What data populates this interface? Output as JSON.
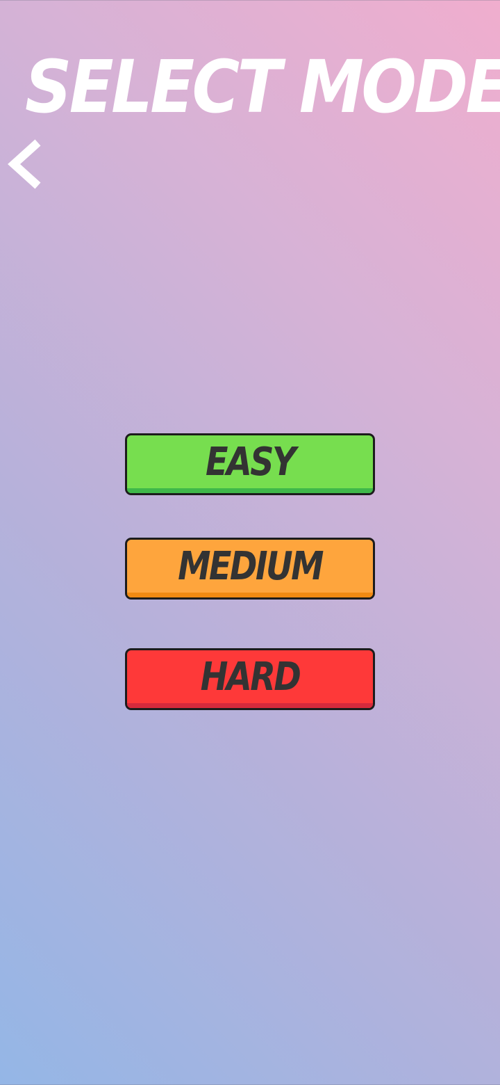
{
  "screen": {
    "title": "SELECT MODE",
    "back_icon": "chevron-left-icon"
  },
  "modes": [
    {
      "label": "EASY",
      "color": "#77de4f"
    },
    {
      "label": "MEDIUM",
      "color": "#fea53d"
    },
    {
      "label": "HARD",
      "color": "#fe3939"
    }
  ],
  "colors": {
    "title_text": "#ffffff",
    "button_text": "#333333",
    "button_border": "#1c1c1c"
  }
}
